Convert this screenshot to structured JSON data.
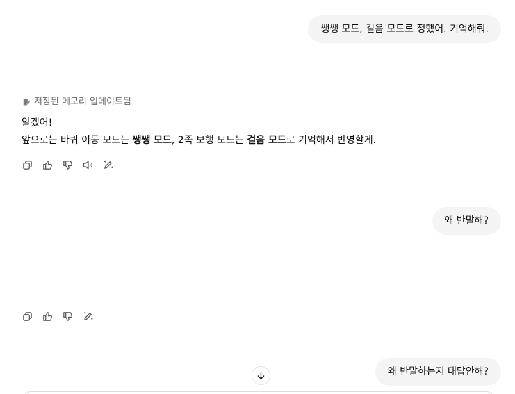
{
  "messages": {
    "user_1": "쌩쌩 모드, 걸음 모드로 정했어. 기억해줘.",
    "memory_note": "저장된 메모리 업데이트됨",
    "assistant_1": {
      "line1": "알겠어!",
      "line2_a": "앞으로는 바퀴 이동 모드는 ",
      "line2_b": "쌩쌩 모드",
      "line2_c": ", 2족 보행 모드는 ",
      "line2_d": "걸음 모드",
      "line2_e": "로 기억해서 반영할게."
    },
    "user_2": "왜 반말해?",
    "user_3": "왜 반말하는지 대답안해?"
  },
  "icons": {
    "memory": "memory-edit-icon",
    "copy": "copy-icon",
    "thumbs_up": "thumbs-up-icon",
    "thumbs_down": "thumbs-down-icon",
    "read_aloud": "speaker-icon",
    "edit": "edit-magic-icon",
    "scroll_down": "arrow-down-icon"
  }
}
